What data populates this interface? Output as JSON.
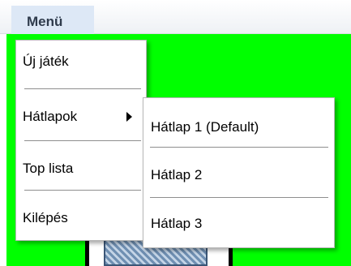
{
  "menubar": {
    "title": "Menü"
  },
  "menu": {
    "items": [
      {
        "label": "Új játék"
      },
      {
        "label": "Hátlapok",
        "has_submenu": true
      },
      {
        "label": "Top lista"
      },
      {
        "label": "Kilépés"
      }
    ]
  },
  "submenu": {
    "items": [
      {
        "label": "Hátlap 1 (Default)"
      },
      {
        "label": "Hátlap 2"
      },
      {
        "label": "Hátlap 3"
      }
    ]
  },
  "colors": {
    "game_background": "#00ff00",
    "menu_title_background": "#dde8f6"
  },
  "icons": {
    "submenu_arrow": "triangle-right-icon"
  }
}
